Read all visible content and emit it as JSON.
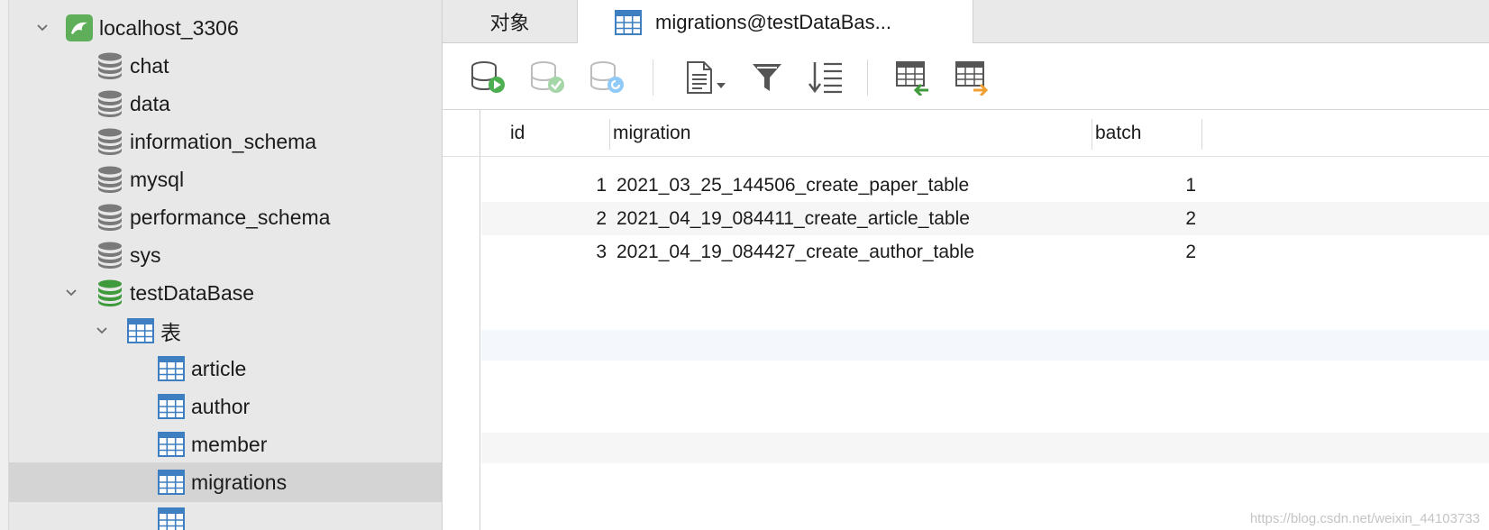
{
  "sidebar": {
    "connection": "localhost_3306",
    "databases": [
      "chat",
      "data",
      "information_schema",
      "mysql",
      "performance_schema",
      "sys"
    ],
    "open_database": "testDataBase",
    "tables_group": "表",
    "tables": [
      "article",
      "author",
      "member",
      "migrations"
    ],
    "selected_table": "migrations"
  },
  "tabs": [
    {
      "label": "对象",
      "active": false
    },
    {
      "label": "migrations@testDataBas...",
      "active": true
    }
  ],
  "toolbar": {
    "buttons": [
      "start-transaction-icon",
      "commit-icon",
      "rollback-icon",
      "text-icon",
      "filter-icon",
      "sort-icon",
      "import-icon",
      "export-icon"
    ]
  },
  "grid": {
    "columns": [
      "id",
      "migration",
      "batch"
    ],
    "rows": [
      {
        "id": "1",
        "migration": "2021_03_25_144506_create_paper_table",
        "batch": "1"
      },
      {
        "id": "2",
        "migration": "2021_04_19_084411_create_article_table",
        "batch": "2"
      },
      {
        "id": "3",
        "migration": "2021_04_19_084427_create_author_table",
        "batch": "2"
      }
    ]
  },
  "watermark": "https://blog.csdn.net/weixin_44103733",
  "colors": {
    "db_gray": "#7a7a7a",
    "db_green": "#3f9a3b",
    "table_blue": "#3d7fc1",
    "mysql_green": "#5fae5a"
  }
}
